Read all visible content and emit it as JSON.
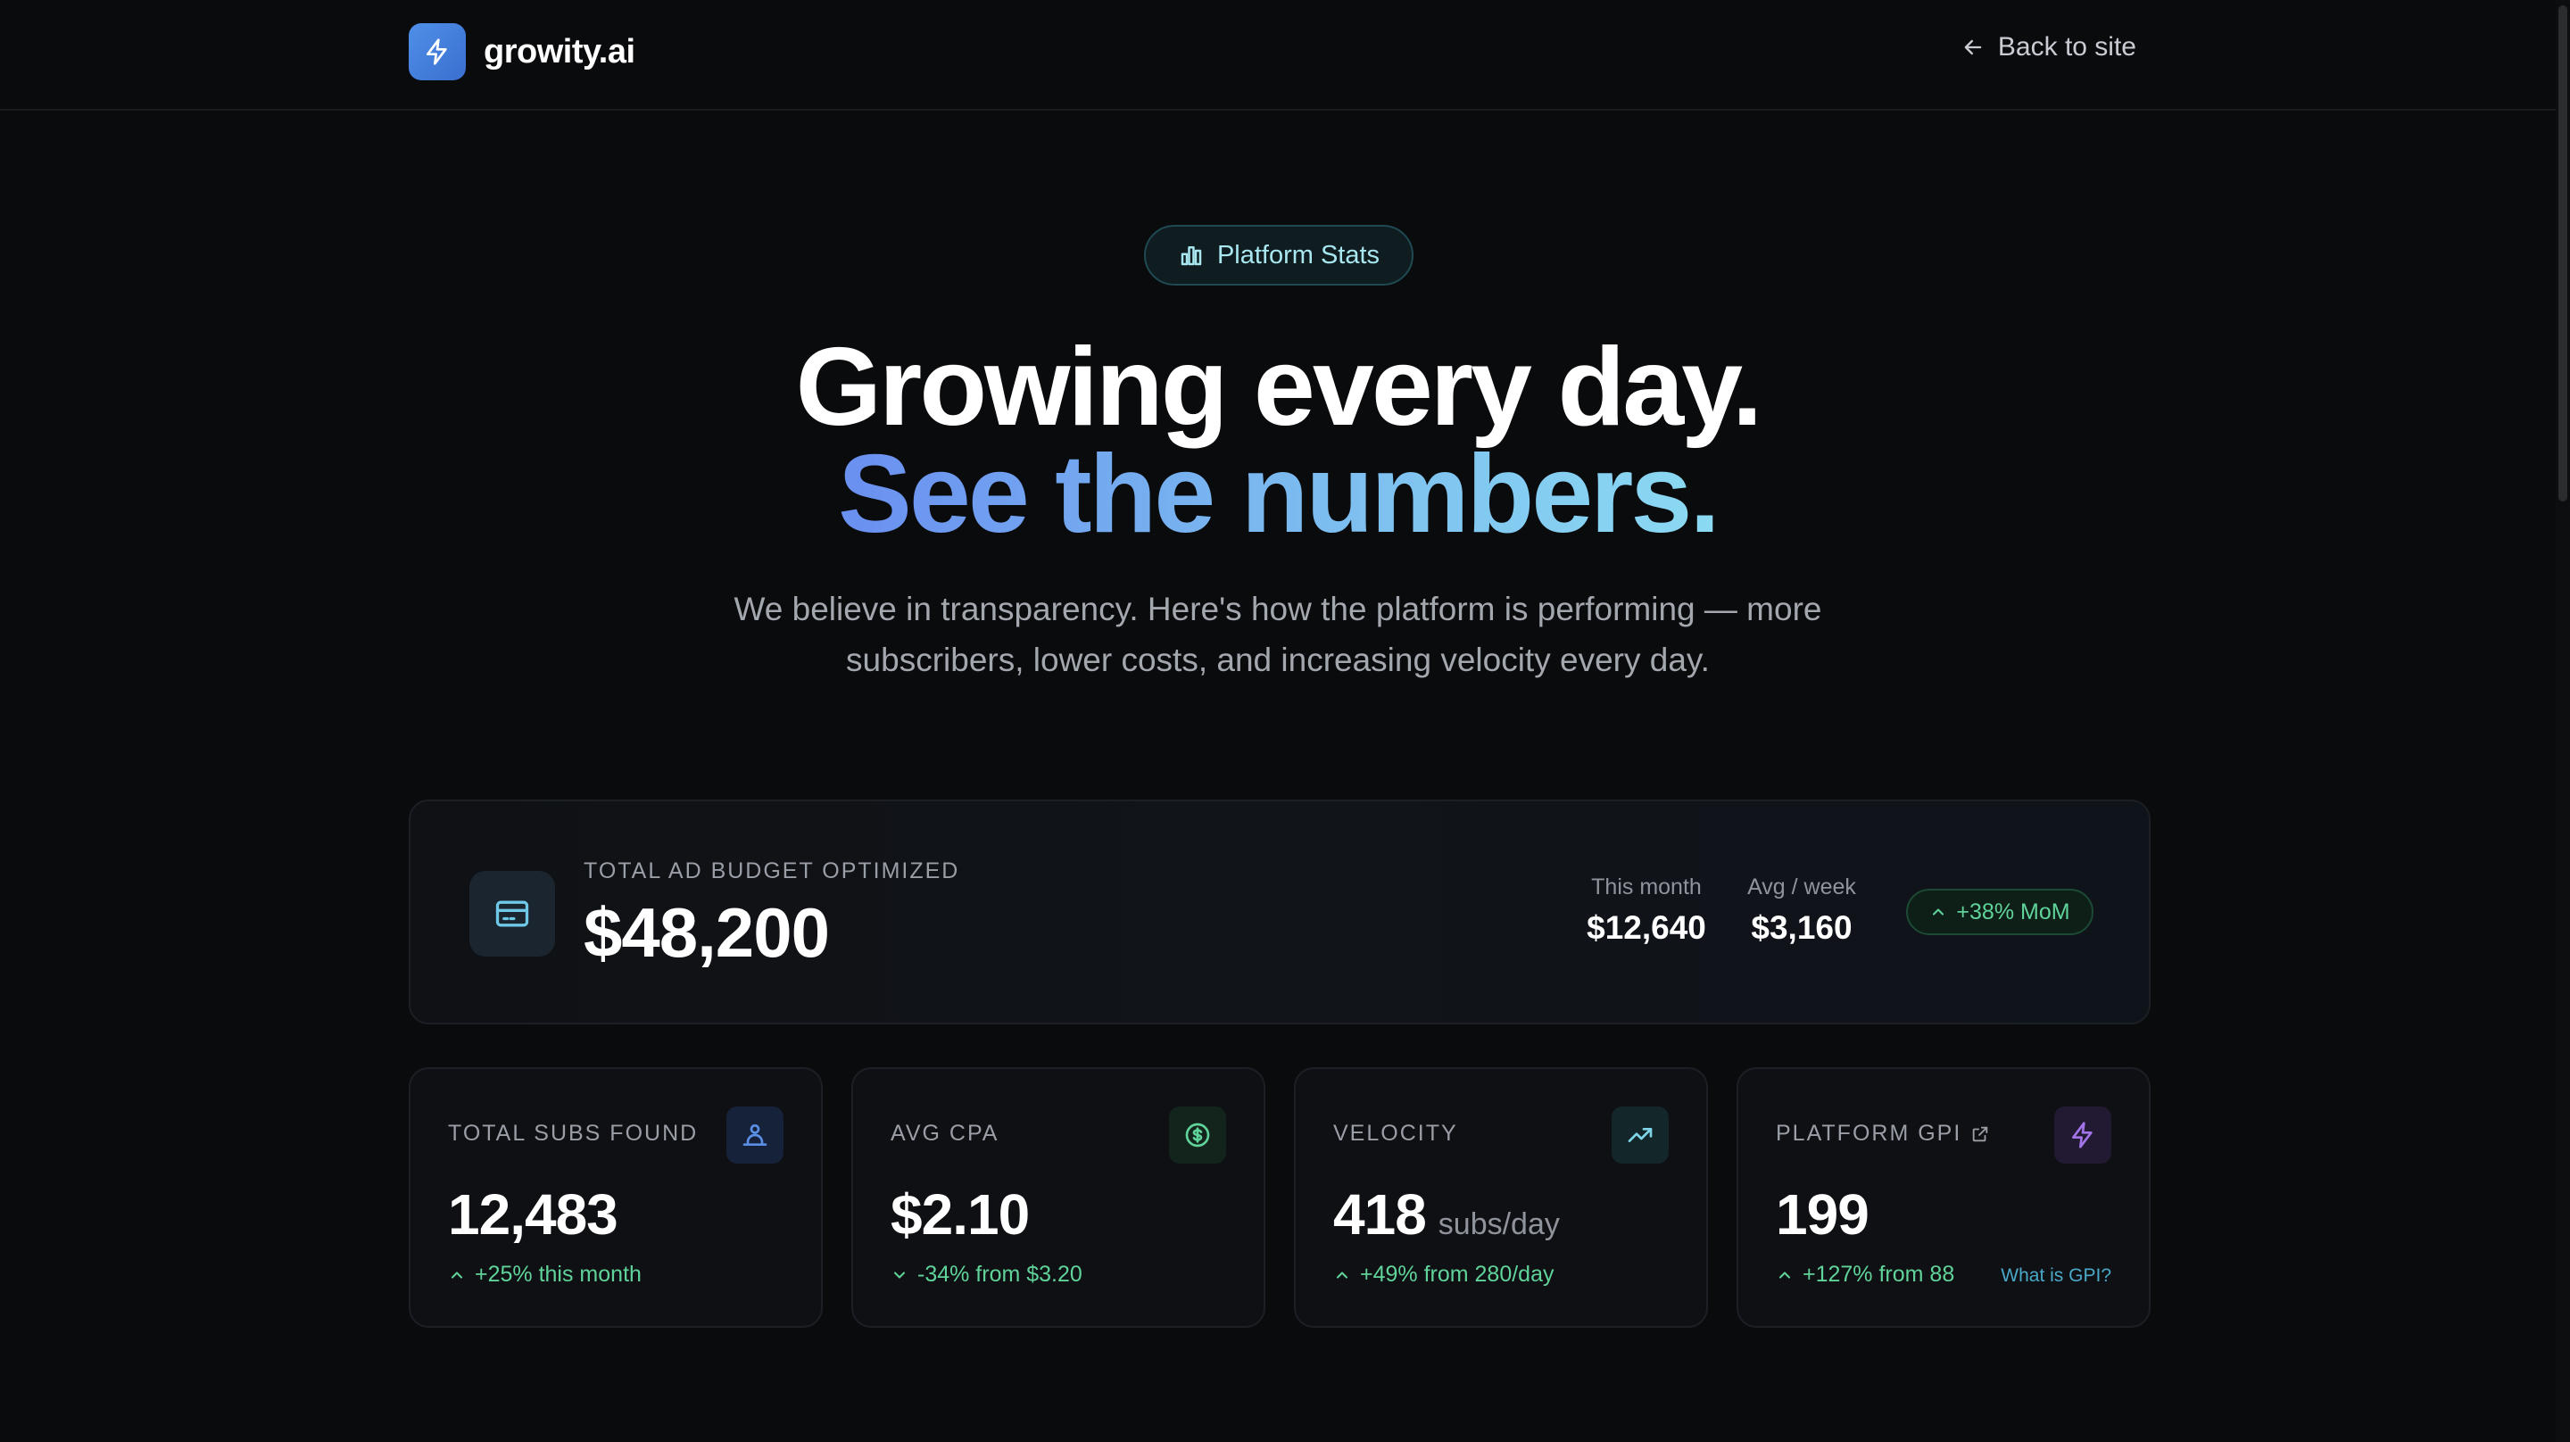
{
  "colors": {
    "background": "#0a0b0d",
    "accent_blue": "#4f8fe8",
    "accent_green": "#5fd39a",
    "accent_cyan": "#a8e6f0",
    "accent_purple": "#a274e8"
  },
  "header": {
    "brand_name": "growity.ai",
    "brand_icon": "lightning-icon",
    "back_label": "Back to site",
    "back_icon": "arrow-left-icon"
  },
  "hero": {
    "pill_label": "Platform Stats",
    "pill_icon": "bar-chart-icon",
    "title_line1": "Growing every day.",
    "title_line2": "See the numbers.",
    "subtitle": "We believe in transparency. Here's how the platform is performing — more subscribers, lower costs, and increasing velocity every day."
  },
  "budget": {
    "icon": "credit-card-icon",
    "label": "TOTAL AD BUDGET OPTIMIZED",
    "value": "$48,200",
    "this_month_label": "This month",
    "this_month_value": "$12,640",
    "avg_week_label": "Avg / week",
    "avg_week_value": "$3,160",
    "mom_badge": "+38% MoM"
  },
  "cards": [
    {
      "label": "TOTAL SUBS FOUND",
      "icon": "users-icon",
      "value": "12,483",
      "unit": "",
      "delta": "+25% this month",
      "delta_direction": "up"
    },
    {
      "label": "AVG CPA",
      "icon": "dollar-circle-icon",
      "value": "$2.10",
      "unit": "",
      "delta": "-34% from $3.20",
      "delta_direction": "down"
    },
    {
      "label": "VELOCITY",
      "icon": "trending-up-icon",
      "value": "418",
      "unit": "subs/day",
      "delta": "+49% from 280/day",
      "delta_direction": "up"
    },
    {
      "label": "PLATFORM GPI",
      "icon": "lightning-icon",
      "label_icon": "external-link-icon",
      "value": "199",
      "unit": "",
      "delta": "+127% from 88",
      "delta_direction": "up",
      "link": "What is GPI?"
    }
  ]
}
